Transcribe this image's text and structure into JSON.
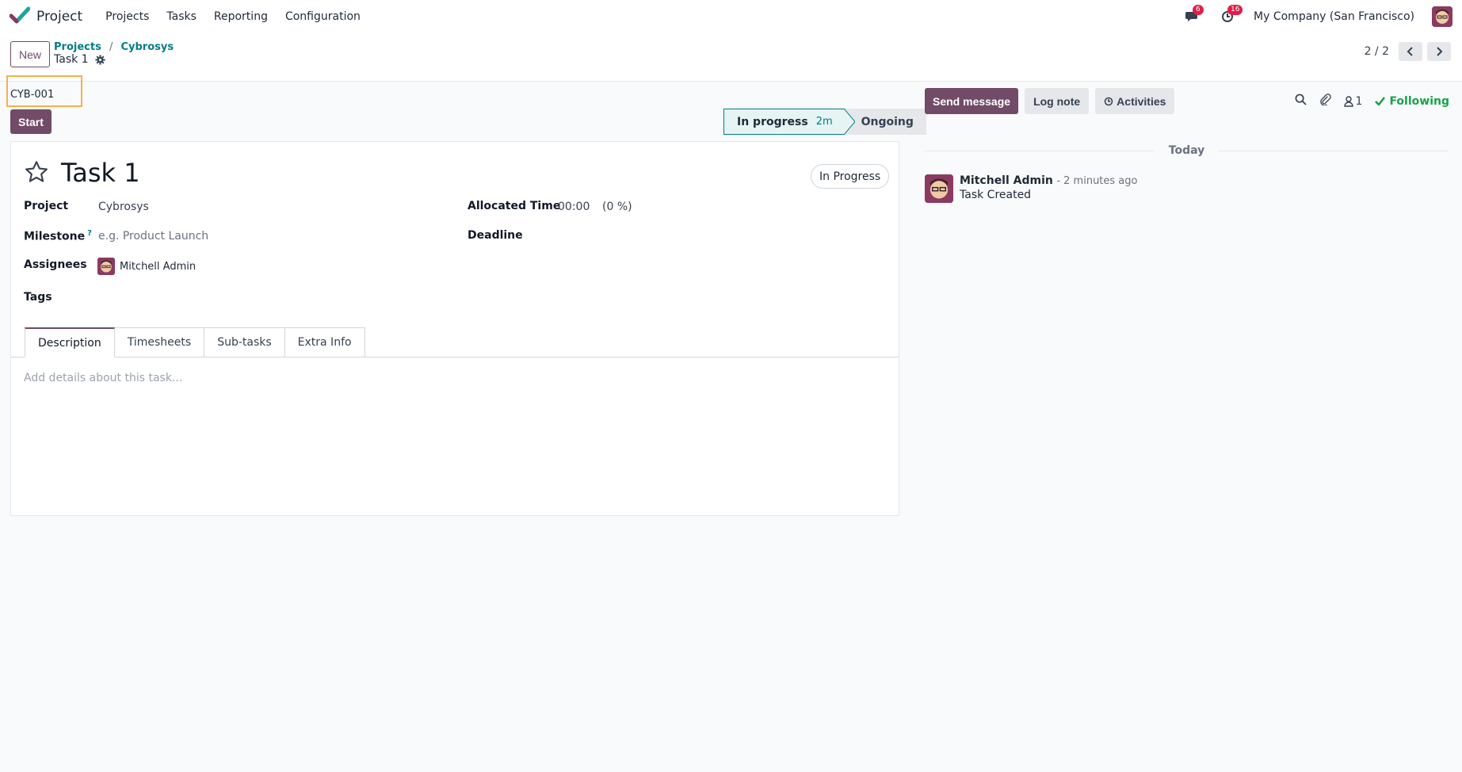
{
  "app": {
    "name": "Project"
  },
  "nav": {
    "items": [
      "Projects",
      "Tasks",
      "Reporting",
      "Configuration"
    ]
  },
  "systray": {
    "messages_count": "6",
    "activities_count": "16",
    "company": "My Company (San Francisco)"
  },
  "control": {
    "new_label": "New",
    "breadcrumb": [
      "Projects",
      "Cybrosys"
    ],
    "current": "Task 1",
    "pager": "2 / 2"
  },
  "form": {
    "reference": "CYB-001",
    "start_label": "Start",
    "stages": {
      "active": "In progress",
      "active_duration": "2m",
      "next": "Ongoing"
    },
    "title": "Task 1",
    "state": "In Progress",
    "fields": {
      "project_label": "Project",
      "project_value": "Cybrosys",
      "milestone_label": "Milestone",
      "milestone_help": "?",
      "milestone_placeholder": "e.g. Product Launch",
      "assignees_label": "Assignees",
      "assignee_name": "Mitchell Admin",
      "tags_label": "Tags",
      "allocated_label": "Allocated Time",
      "allocated_value": "00:00",
      "allocated_pct": "(0 %)",
      "deadline_label": "Deadline"
    },
    "tabs": [
      "Description",
      "Timesheets",
      "Sub-tasks",
      "Extra Info"
    ],
    "description_placeholder": "Add details about this task..."
  },
  "chatter": {
    "send_label": "Send message",
    "log_label": "Log note",
    "activities_label": "Activities",
    "followers_count": "1",
    "following_label": "Following",
    "date_separator": "Today",
    "message": {
      "author": "Mitchell Admin",
      "time": "- 2 minutes ago",
      "body": "Task Created"
    }
  },
  "colors": {
    "brand": "#714b67",
    "teal": "#017e84",
    "highlight": "#f5b14a",
    "following": "#16a34a"
  }
}
